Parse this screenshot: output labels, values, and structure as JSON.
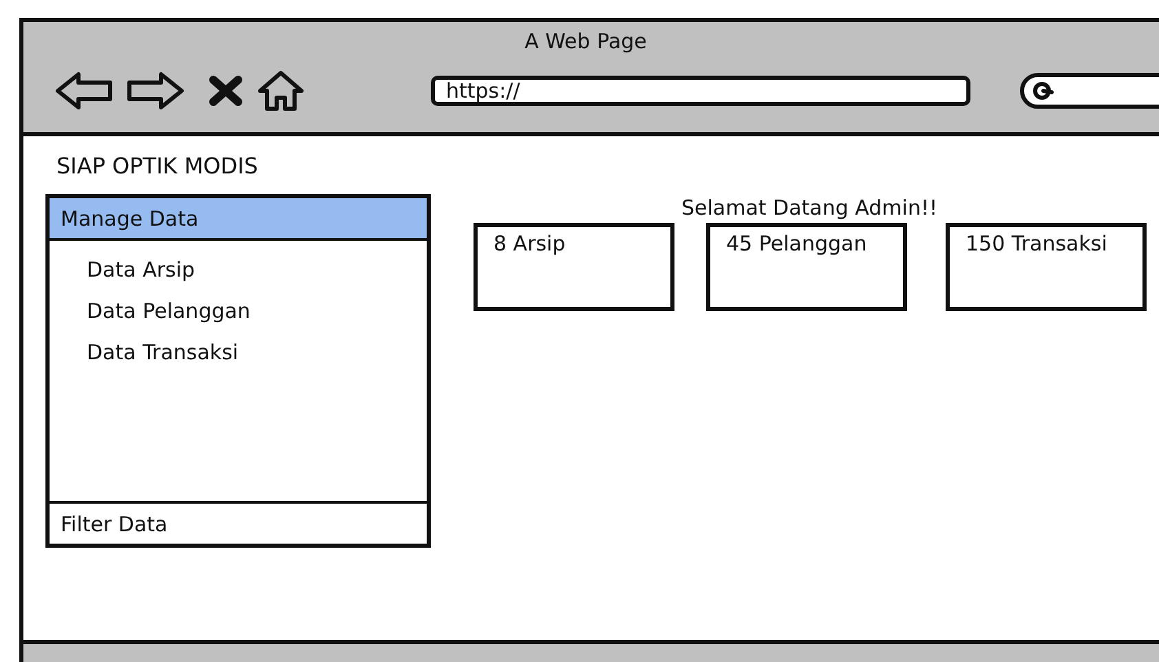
{
  "window": {
    "title": "A Web Page"
  },
  "address_bar": {
    "value": "https://"
  },
  "site_title": "SIAP OPTIK MODIS",
  "sidebar": {
    "sections": [
      {
        "label": "Manage Data",
        "selected": true,
        "children": [
          {
            "label": "Data Arsip"
          },
          {
            "label": "Data Pelanggan"
          },
          {
            "label": "Data Transaksi"
          }
        ]
      },
      {
        "label": "Filter Data",
        "selected": false
      }
    ]
  },
  "welcome": "Selamat Datang Admin!!",
  "cards": [
    {
      "text": "8 Arsip"
    },
    {
      "text": "45 Pelanggan"
    },
    {
      "text": "150 Transaksi"
    }
  ]
}
